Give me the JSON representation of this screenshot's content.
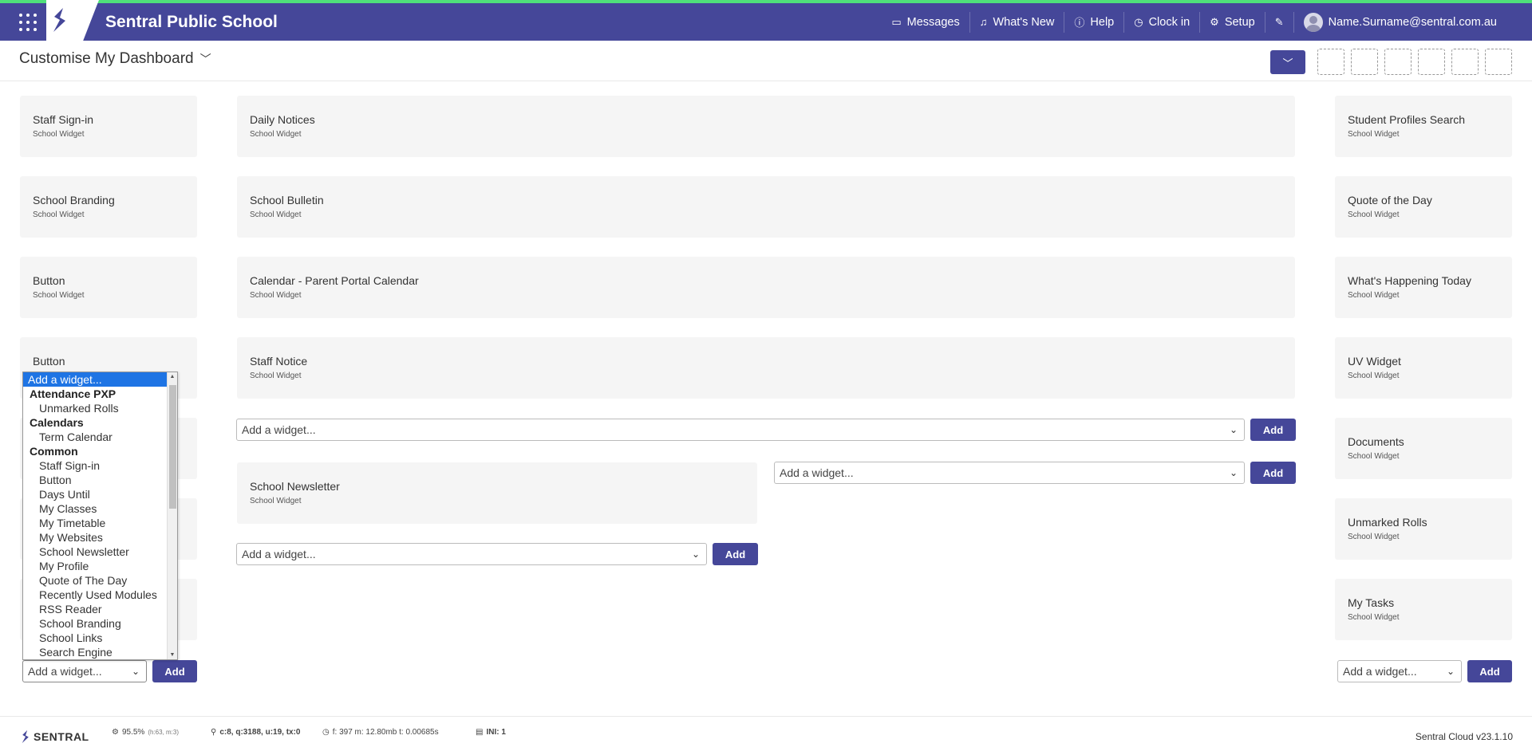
{
  "topbar": {
    "school_name": "Sentral Public School",
    "nav": {
      "messages": "Messages",
      "whats_new": "What's New",
      "help": "Help",
      "clock_in": "Clock in",
      "setup": "Setup",
      "user": "Name.Surname@sentral.com.au"
    }
  },
  "subheader": {
    "title": "Customise My Dashboard"
  },
  "widget_subtitle": "School Widget",
  "left_column": {
    "widgets": [
      "Staff Sign-in",
      "School Branding",
      "Button",
      "Button"
    ],
    "add_select": "Add a widget...",
    "add_button": "Add"
  },
  "center_column": {
    "widgets": [
      "Daily Notices",
      "School Bulletin",
      "Calendar - Parent Portal Calendar",
      "Staff Notice"
    ],
    "add_select_1": "Add a widget...",
    "add_button_1": "Add",
    "newsletter": "School Newsletter",
    "add_select_left": "Add a widget...",
    "add_button_left": "Add",
    "add_select_right": "Add a widget...",
    "add_button_right": "Add"
  },
  "right_column": {
    "widgets": [
      "Student Profiles Search",
      "Quote of the Day",
      "What's Happening Today",
      "UV Widget",
      "Documents",
      "Unmarked Rolls",
      "My Tasks"
    ],
    "add_select": "Add a widget...",
    "add_button": "Add"
  },
  "dropdown": {
    "selected": "Add a widget...",
    "groups": [
      {
        "label": "Attendance PXP",
        "items": [
          "Unmarked Rolls"
        ]
      },
      {
        "label": "Calendars",
        "items": [
          "Term Calendar"
        ]
      },
      {
        "label": "Common",
        "items": [
          "Staff Sign-in",
          "Button",
          "Days Until",
          "My Classes",
          "My Timetable",
          "My Websites",
          "School Newsletter",
          "My Profile",
          "Quote of The Day",
          "Recently Used Modules",
          "RSS Reader",
          "School Branding",
          "School Links",
          "Search Engine"
        ]
      }
    ]
  },
  "footer": {
    "logo": "SENTRAL",
    "stat1_main": "95.5%",
    "stat1_sub": "(h:63, m:3)",
    "stat2": "c:8, q:3188, u:19, tx:0",
    "stat3": "f: 397 m: 12.80mb t: 0.00685s",
    "stat4": "INI: 1",
    "version": "Sentral Cloud v23.1.10"
  },
  "colors": {
    "brand": "#454799",
    "accent": "#4fe07a",
    "selected": "#1e74e4"
  }
}
